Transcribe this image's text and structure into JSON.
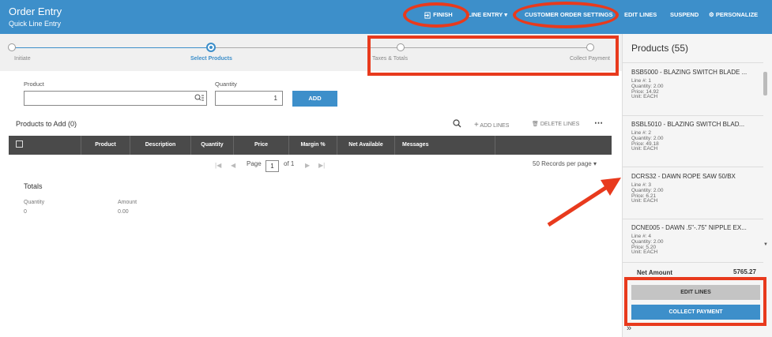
{
  "header": {
    "title": "Order Entry",
    "subtitle": "Quick Line Entry",
    "finish": "FINISH",
    "line_entry": "LINE ENTRY",
    "customer_order_settings": "CUSTOMER ORDER SETTINGS",
    "edit_lines": "EDIT LINES",
    "suspend": "SUSPEND",
    "personalize": "PERSONALIZE"
  },
  "stepper": {
    "steps": [
      "Initiate",
      "Select Products",
      "Taxes & Totals",
      "Collect Payment"
    ]
  },
  "entry": {
    "product_label": "Product",
    "quantity_label": "Quantity",
    "quantity_value": "1",
    "add_label": "ADD"
  },
  "list": {
    "title": "Products to Add (0)",
    "add_lines": "ADD LINES",
    "delete_lines": "DELETE LINES",
    "columns": [
      "Product",
      "Description",
      "Quantity",
      "Price",
      "Margin %",
      "Net Available",
      "Messages"
    ]
  },
  "pager": {
    "page_label": "Page",
    "page_value": "1",
    "of_label": "of 1",
    "records": "50 Records per page"
  },
  "totals": {
    "title": "Totals",
    "quantity_label": "Quantity",
    "quantity_value": "0",
    "amount_label": "Amount",
    "amount_value": "0.00"
  },
  "sidebar": {
    "title": "Products (55)",
    "products": [
      {
        "name": "BSB5000 - BLAZING SWITCH BLADE ...",
        "line": "Line #: 1",
        "quantity": "Quantity: 2.00",
        "price": "Price: 14.92",
        "unit": "Unit: EACH"
      },
      {
        "name": "BSBL5010 - BLAZING SWITCH BLAD...",
        "line": "Line #: 2",
        "quantity": "Quantity: 2.00",
        "price": "Price: 49.18",
        "unit": "Unit: EACH"
      },
      {
        "name": "DCRS32 - DAWN ROPE SAW 50/BX",
        "line": "Line #: 3",
        "quantity": "Quantity: 2.00",
        "price": "Price: 6.21",
        "unit": "Unit: EACH"
      },
      {
        "name": "DCNE005 - DAWN .5\"-.75\" NIPPLE EX...",
        "line": "Line #: 4",
        "quantity": "Quantity: 2.00",
        "price": "Price: 5.20",
        "unit": "Unit: EACH"
      }
    ],
    "net_amount_label": "Net Amount",
    "net_amount_value": "5765.27",
    "edit_lines": "EDIT LINES",
    "collect_payment": "COLLECT PAYMENT",
    "collapse": "»"
  },
  "colors": {
    "accent": "#3d8fca",
    "header_bg": "#3d8fca",
    "grid_header": "#4a4a4a",
    "annotation": "#e83a1d"
  }
}
